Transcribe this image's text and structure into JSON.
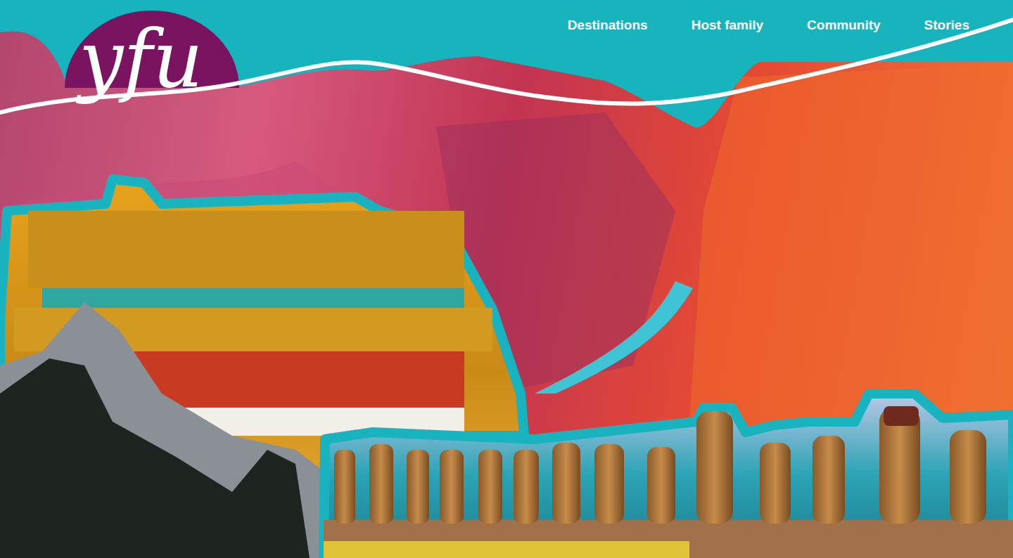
{
  "logo": "yfu",
  "nav": [
    {
      "label": "Destinations"
    },
    {
      "label": "Host family"
    },
    {
      "label": "Community"
    },
    {
      "label": "Stories"
    }
  ]
}
